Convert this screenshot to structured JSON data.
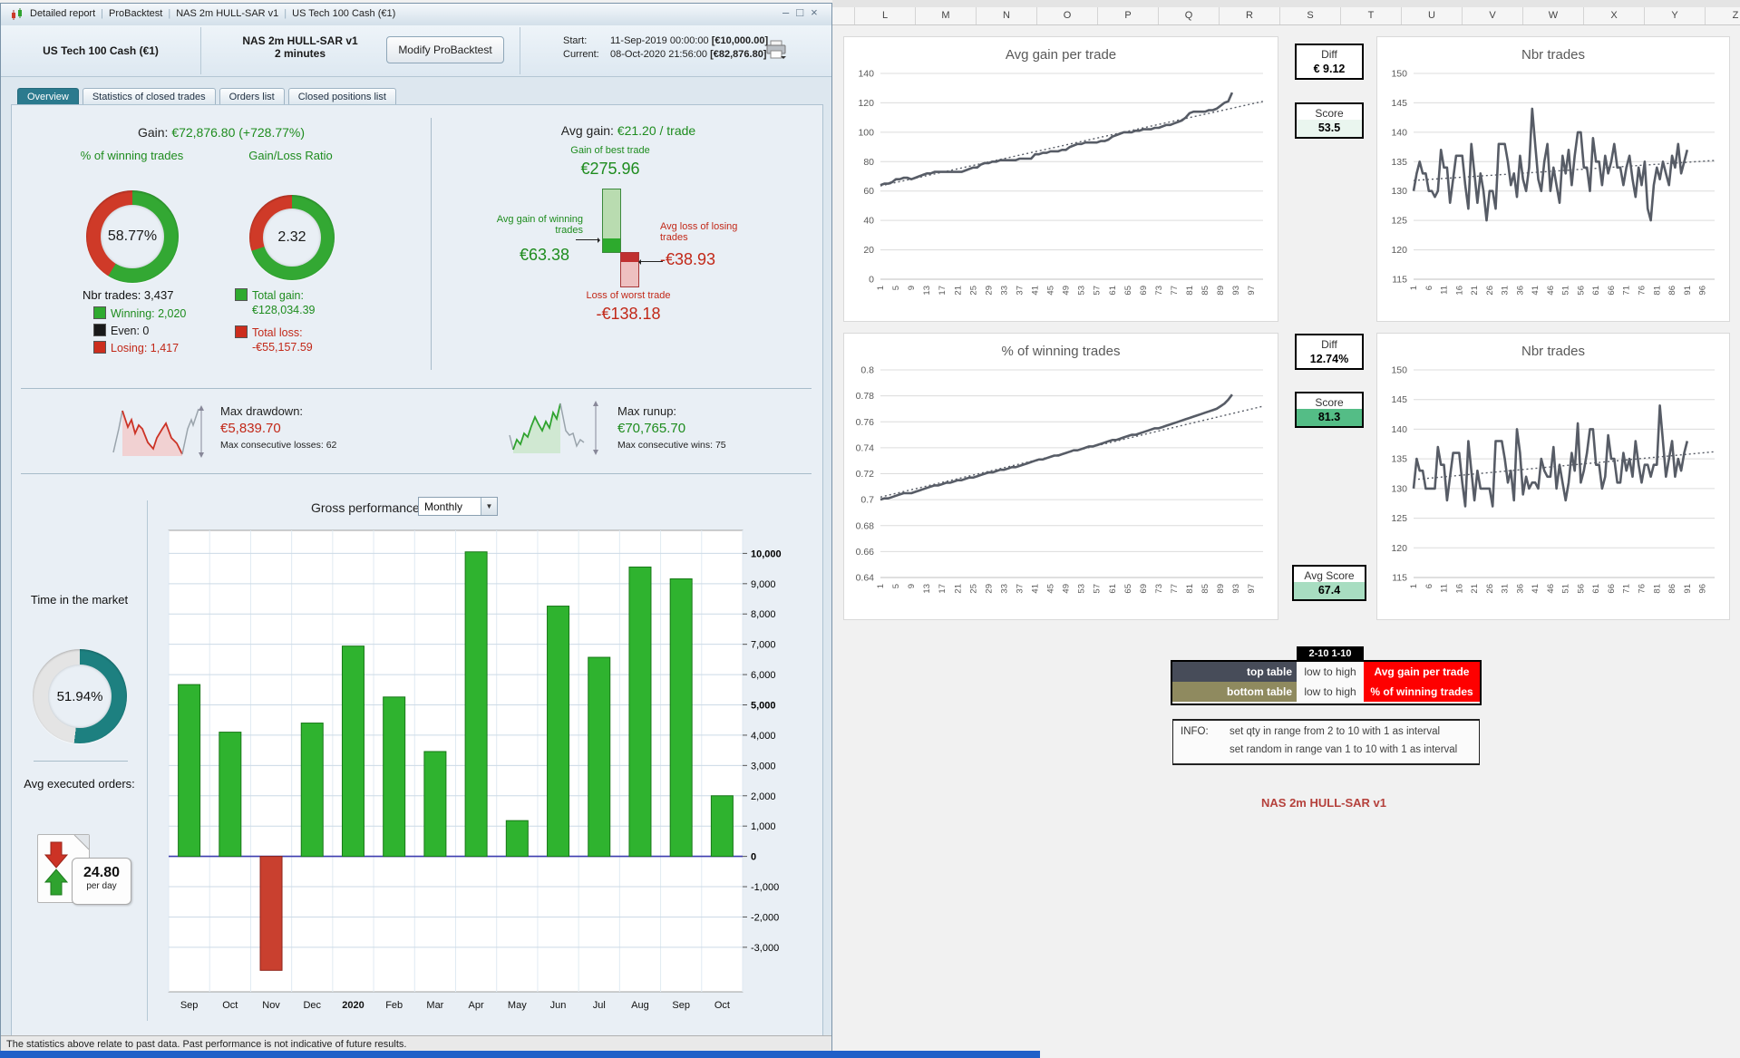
{
  "window": {
    "title_items": [
      "Detailed report",
      "ProBacktest",
      "NAS 2m HULL-SAR v1",
      "US Tech 100 Cash (€1)"
    ],
    "controls": {
      "minimize": "–",
      "maximize": "□",
      "close": "×"
    },
    "instrument": "US Tech 100 Cash (€1)",
    "strategy_name": "NAS 2m HULL-SAR v1",
    "timeframe": "2 minutes",
    "modify_button": "Modify ProBacktest",
    "start_label": "Start:",
    "start_value": "11-Sep-2019 00:00:00",
    "start_capital": "[€10,000.00]",
    "current_label": "Current:",
    "current_value": "08-Oct-2020 21:56:00",
    "current_capital": "[€82,876.80]",
    "tabs": [
      {
        "label": "Overview",
        "active": true
      },
      {
        "label": "Statistics of closed trades",
        "active": false
      },
      {
        "label": "Orders list",
        "active": false
      },
      {
        "label": "Closed positions list",
        "active": false
      }
    ],
    "status_bar": "The statistics above relate to past data. Past performance is not indicative of future results."
  },
  "overview": {
    "gain_label": "Gain:",
    "gain_value": "€72,876.80 (+728.77%)",
    "winning_donut": {
      "title": "% of winning trades",
      "center": "58.77%",
      "pct": 58.77,
      "c1": "#33a833",
      "c2": "#cf3a28"
    },
    "ratio_donut": {
      "title": "Gain/Loss Ratio",
      "center": "2.32",
      "pct": 69.9,
      "c1": "#33a833",
      "c2": "#cf3a28"
    },
    "nbr_trades": "Nbr trades: 3,437",
    "legend": [
      {
        "label": "Winning: 2,020",
        "color": "#2faa2f"
      },
      {
        "label": "Even: 0",
        "color": "#1a1a1a"
      },
      {
        "label": "Losing: 1,417",
        "color": "#cc2d1d"
      }
    ],
    "total_gain_label": "Total gain:",
    "total_gain_value": "€128,034.39",
    "total_loss_label": "Total loss:",
    "total_loss_value": "-€55,157.59",
    "avg_gain_label": "Avg gain:",
    "avg_gain_value": "€21.20 / trade",
    "best_trade_label": "Gain of best trade",
    "best_trade_value": "€275.96",
    "avg_win_label1": "Avg gain of winning",
    "avg_win_label2": "trades",
    "avg_win_value": "€63.38",
    "avg_loss_label1": "Avg loss of losing",
    "avg_loss_label2": "trades",
    "avg_loss_value": "-€38.93",
    "worst_trade_label": "Loss of worst trade",
    "worst_trade_value": "-€138.18",
    "max_dd_label": "Max drawdown:",
    "max_dd_value": "€5,839.70",
    "max_dd_sub": "Max consecutive losses: 62",
    "max_ru_label": "Max runup:",
    "max_ru_value": "€70,765.70",
    "max_ru_sub": "Max consecutive wins: 75"
  },
  "gross": {
    "title": "Gross performance",
    "dropdown_value": "Monthly",
    "time_label": "Time in the market",
    "time_donut": {
      "center": "51.94%",
      "pct": 51.94,
      "c1": "#1d8080",
      "c2": "#e4e4e4"
    },
    "avg_orders_label": "Avg executed orders:",
    "avg_orders_value": "24.80",
    "avg_orders_unit": "per day",
    "chart": {
      "type": "bar",
      "ymax": 10760,
      "ymin": -4470,
      "yticks": [
        {
          "v": 10000,
          "l": "10,000",
          "b": 1
        },
        {
          "v": 9000,
          "l": "9,000"
        },
        {
          "v": 8000,
          "l": "8,000"
        },
        {
          "v": 7000,
          "l": "7,000"
        },
        {
          "v": 6000,
          "l": "6,000"
        },
        {
          "v": 5000,
          "l": "5,000",
          "b": 1
        },
        {
          "v": 4000,
          "l": "4,000"
        },
        {
          "v": 3000,
          "l": "3,000"
        },
        {
          "v": 2000,
          "l": "2,000"
        },
        {
          "v": 1000,
          "l": "1,000"
        },
        {
          "v": 0,
          "l": "0",
          "b": 1
        },
        {
          "v": -1000,
          "l": "-1,000"
        },
        {
          "v": -2000,
          "l": "-2,000"
        },
        {
          "v": -3000,
          "l": "-3,000"
        }
      ],
      "categories": [
        {
          "l": "Sep"
        },
        {
          "l": "Oct"
        },
        {
          "l": "Nov"
        },
        {
          "l": "Dec"
        },
        {
          "l": "2020",
          "b": 1
        },
        {
          "l": "Feb"
        },
        {
          "l": "Mar"
        },
        {
          "l": "Apr"
        },
        {
          "l": "May"
        },
        {
          "l": "Jun"
        },
        {
          "l": "Jul"
        },
        {
          "l": "Aug"
        },
        {
          "l": "Sep"
        },
        {
          "l": "Oct"
        }
      ],
      "values": [
        5670,
        4100,
        -3760,
        4400,
        6940,
        5260,
        3460,
        10050,
        1180,
        8260,
        6570,
        9550,
        9160,
        2000
      ]
    }
  },
  "sheet": {
    "columns": [
      "L",
      "M",
      "N",
      "O",
      "P",
      "Q",
      "R",
      "S",
      "T",
      "U",
      "V",
      "W",
      "X",
      "Y",
      "Z"
    ],
    "kpi": {
      "diff1_label": "Diff",
      "diff1_value": "€ 9.12",
      "score1_label": "Score",
      "score1_value": "53.5",
      "score1_bg": "#eaf6ef",
      "diff2_label": "Diff",
      "diff2_value": "12.74%",
      "score2_label": "Score",
      "score2_value": "81.3",
      "score2_bg": "#54bd86",
      "avgscore_label": "Avg Score",
      "avgscore_value": "67.4",
      "avgscore_bg": "#a8ddc1"
    },
    "charts": {
      "avg_gain": {
        "type": "line",
        "title": "Avg gain per trade",
        "ymin": 0,
        "ymax": 140,
        "xmax": 100,
        "yticks": [
          {
            "v": 140,
            "l": "140"
          },
          {
            "v": 120,
            "l": "120"
          },
          {
            "v": 100,
            "l": "100"
          },
          {
            "v": 80,
            "l": "80"
          },
          {
            "v": 60,
            "l": "60"
          },
          {
            "v": 40,
            "l": "40"
          },
          {
            "v": 20,
            "l": "20"
          },
          {
            "v": 0,
            "l": "0"
          }
        ],
        "xticks": [
          "1",
          "5",
          "9",
          "13",
          "17",
          "21",
          "25",
          "29",
          "33",
          "37",
          "41",
          "45",
          "49",
          "53",
          "57",
          "61",
          "65",
          "69",
          "73",
          "77",
          "81",
          "85",
          "89",
          "93",
          "97"
        ],
        "trend": [
          1,
          63.5,
          100,
          121
        ],
        "values": [
          64,
          65,
          65,
          66,
          68,
          68,
          69,
          69,
          68,
          69,
          70,
          71,
          72,
          72,
          73,
          73,
          73,
          73,
          73,
          73,
          73,
          73,
          74,
          75,
          76,
          76,
          78,
          79,
          79,
          80,
          80,
          81,
          81,
          81,
          81,
          81,
          82,
          82,
          82,
          82,
          85,
          85,
          86,
          86,
          87,
          87,
          87,
          88,
          88,
          90,
          91,
          92,
          92,
          93,
          93,
          93,
          93,
          94,
          94,
          95,
          97,
          98,
          99,
          100,
          100,
          100,
          101,
          101,
          102,
          102,
          102,
          103,
          103,
          104,
          105,
          105,
          106,
          107,
          108,
          110,
          113,
          114,
          114,
          114,
          114,
          115,
          115,
          116,
          118,
          120,
          121,
          127
        ]
      },
      "nbr_top": {
        "type": "line",
        "title": "Nbr trades",
        "ymin": 115,
        "ymax": 150,
        "xmax": 100,
        "yticks": [
          {
            "v": 150,
            "l": "150"
          },
          {
            "v": 145,
            "l": "145"
          },
          {
            "v": 140,
            "l": "140"
          },
          {
            "v": 135,
            "l": "135"
          },
          {
            "v": 130,
            "l": "130"
          },
          {
            "v": 125,
            "l": "125"
          },
          {
            "v": 120,
            "l": "120"
          },
          {
            "v": 115,
            "l": "115"
          }
        ],
        "xticks": [
          "1",
          "6",
          "11",
          "16",
          "21",
          "26",
          "31",
          "36",
          "41",
          "46",
          "51",
          "56",
          "61",
          "66",
          "71",
          "76",
          "81",
          "86",
          "91",
          "96"
        ],
        "trend": [
          1,
          131.8,
          100,
          135.2
        ],
        "values": [
          130,
          133,
          135,
          133,
          133,
          130,
          130,
          129,
          130,
          137,
          134,
          134,
          128,
          132,
          136,
          136,
          136,
          131,
          127,
          138,
          133,
          128,
          133,
          130,
          125,
          130,
          130,
          127,
          138,
          138,
          138,
          135,
          131,
          133,
          129,
          136,
          132,
          130,
          134,
          144,
          138,
          132,
          130,
          135,
          138,
          130,
          134,
          131,
          128,
          136,
          133,
          137,
          131,
          136,
          140,
          140,
          134,
          134,
          130,
          139,
          135,
          135,
          131,
          136,
          133,
          135,
          138,
          134,
          134,
          131,
          134,
          136,
          132,
          129,
          134,
          131,
          135,
          127,
          125,
          131,
          134,
          132,
          135,
          133,
          131,
          136,
          134,
          138,
          133,
          135,
          137
        ]
      },
      "pct_win": {
        "type": "line",
        "title": "% of winning trades",
        "ymin": 0.64,
        "ymax": 0.8,
        "xmax": 100,
        "yticks": [
          {
            "v": 0.8,
            "l": "0.8"
          },
          {
            "v": 0.78,
            "l": "0.78"
          },
          {
            "v": 0.76,
            "l": "0.76"
          },
          {
            "v": 0.74,
            "l": "0.74"
          },
          {
            "v": 0.72,
            "l": "0.72"
          },
          {
            "v": 0.7,
            "l": "0.7"
          },
          {
            "v": 0.68,
            "l": "0.68"
          },
          {
            "v": 0.66,
            "l": "0.66"
          },
          {
            "v": 0.64,
            "l": "0.64"
          }
        ],
        "xticks": [
          "1",
          "5",
          "9",
          "13",
          "17",
          "21",
          "25",
          "29",
          "33",
          "37",
          "41",
          "45",
          "49",
          "53",
          "57",
          "61",
          "65",
          "69",
          "73",
          "77",
          "81",
          "85",
          "89",
          "93",
          "97"
        ],
        "trend": [
          1,
          0.702,
          100,
          0.772
        ],
        "values": [
          0.7,
          0.701,
          0.701,
          0.702,
          0.703,
          0.704,
          0.705,
          0.705,
          0.705,
          0.706,
          0.707,
          0.708,
          0.709,
          0.71,
          0.711,
          0.711,
          0.712,
          0.713,
          0.713,
          0.714,
          0.715,
          0.715,
          0.716,
          0.717,
          0.717,
          0.718,
          0.719,
          0.72,
          0.721,
          0.721,
          0.722,
          0.723,
          0.723,
          0.724,
          0.725,
          0.725,
          0.726,
          0.727,
          0.728,
          0.729,
          0.73,
          0.731,
          0.731,
          0.732,
          0.733,
          0.734,
          0.734,
          0.735,
          0.736,
          0.737,
          0.738,
          0.738,
          0.739,
          0.74,
          0.741,
          0.741,
          0.742,
          0.743,
          0.744,
          0.745,
          0.746,
          0.746,
          0.747,
          0.748,
          0.749,
          0.75,
          0.75,
          0.751,
          0.752,
          0.753,
          0.754,
          0.755,
          0.755,
          0.756,
          0.757,
          0.758,
          0.759,
          0.76,
          0.761,
          0.762,
          0.763,
          0.764,
          0.765,
          0.766,
          0.767,
          0.768,
          0.769,
          0.77,
          0.772,
          0.774,
          0.777,
          0.781
        ]
      },
      "nbr_bottom": {
        "type": "line",
        "title": "Nbr trades",
        "ymin": 115,
        "ymax": 150,
        "xmax": 100,
        "yticks": [
          {
            "v": 150,
            "l": "150"
          },
          {
            "v": 145,
            "l": "145"
          },
          {
            "v": 140,
            "l": "140"
          },
          {
            "v": 135,
            "l": "135"
          },
          {
            "v": 130,
            "l": "130"
          },
          {
            "v": 125,
            "l": "125"
          },
          {
            "v": 120,
            "l": "120"
          },
          {
            "v": 115,
            "l": "115"
          }
        ],
        "xticks": [
          "1",
          "6",
          "11",
          "16",
          "21",
          "26",
          "31",
          "36",
          "41",
          "46",
          "51",
          "56",
          "61",
          "66",
          "71",
          "76",
          "81",
          "86",
          "91",
          "96"
        ],
        "trend": [
          1,
          131.5,
          100,
          136.2
        ],
        "values": [
          130,
          135,
          133,
          133,
          130,
          130,
          130,
          130,
          137,
          134,
          134,
          128,
          132,
          136,
          136,
          136,
          131,
          127,
          138,
          133,
          128,
          133,
          130,
          130,
          130,
          130,
          127,
          138,
          138,
          138,
          135,
          131,
          133,
          128,
          140,
          136,
          129,
          132,
          130,
          131,
          131,
          130,
          135,
          133,
          132,
          132,
          137,
          130,
          134,
          131,
          128,
          131,
          136,
          133,
          141,
          131,
          133,
          136,
          140,
          140,
          134,
          134,
          130,
          132,
          139,
          135,
          135,
          131,
          131,
          136,
          133,
          135,
          132,
          138,
          134,
          131,
          134,
          134,
          132,
          134,
          134,
          144,
          138,
          132,
          135,
          138,
          132,
          135,
          133,
          136,
          138
        ]
      }
    },
    "table": {
      "header": "2-10 1-10",
      "rows": [
        {
          "name": "top table",
          "name_bg": "#474c59",
          "mid": "low to high",
          "metric": "Avg gain per trade",
          "metric_bg": "#fe0000"
        },
        {
          "name": "bottom table",
          "name_bg": "#8f8a5f",
          "mid": "low to high",
          "metric": "% of winning trades",
          "metric_bg": "#fe0000"
        }
      ]
    },
    "info": {
      "label": "INFO:",
      "line1": "set qty in range from 2 to 10 with 1 as interval",
      "line2": "set random in range van 1 to 10 with 1 as interval"
    },
    "footnote": "NAS 2m HULL-SAR v1"
  }
}
